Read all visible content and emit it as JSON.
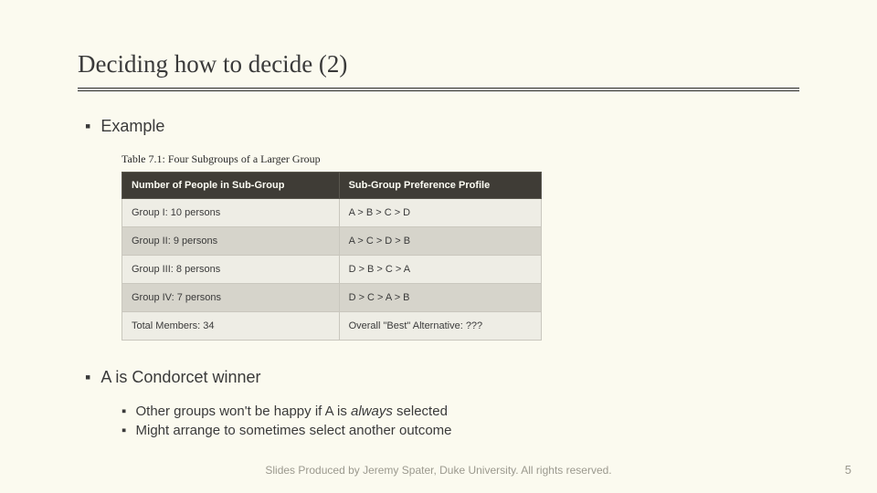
{
  "title": "Deciding how to decide (2)",
  "bullets": {
    "example": "Example",
    "winner_pre": "A is ",
    "winner_post": "Condorcet winner",
    "sub1_pre": "Other groups won't be happy if A is ",
    "sub1_italic": "always",
    "sub1_post": " selected",
    "sub2": "Might arrange to sometimes select another outcome"
  },
  "table": {
    "caption": "Table 7.1:  Four Subgroups of a Larger Group",
    "headers": [
      "Number of People in Sub-Group",
      "Sub-Group Preference Profile"
    ],
    "rows": [
      [
        "Group I: 10 persons",
        "A > B > C > D"
      ],
      [
        "Group II: 9 persons",
        "A > C > D > B"
      ],
      [
        "Group III: 8 persons",
        "D > B > C > A"
      ],
      [
        "Group IV: 7 persons",
        "D > C > A > B"
      ],
      [
        "Total Members: 34",
        "Overall \"Best\" Alternative: ???"
      ]
    ]
  },
  "footer": "Slides Produced by Jeremy Spater, Duke University.  All rights reserved.",
  "page": "5"
}
